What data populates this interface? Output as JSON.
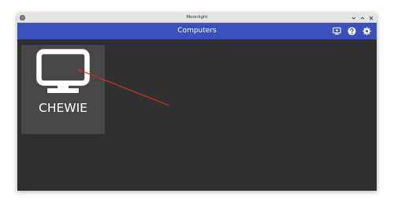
{
  "window": {
    "title": "Moonlight",
    "app_icon": "moonlight-app-icon",
    "controls": [
      "minimize-icon",
      "maximize-icon",
      "close-icon"
    ]
  },
  "toolbar": {
    "title": "Computers",
    "background": "#3a51bd",
    "buttons": [
      {
        "name": "add-pc-icon"
      },
      {
        "name": "help-icon"
      },
      {
        "name": "settings-icon"
      }
    ]
  },
  "computers": [
    {
      "name": "CHEWIE",
      "icon": "monitor-icon"
    }
  ],
  "annotation": {
    "color": "#d42a2a"
  }
}
